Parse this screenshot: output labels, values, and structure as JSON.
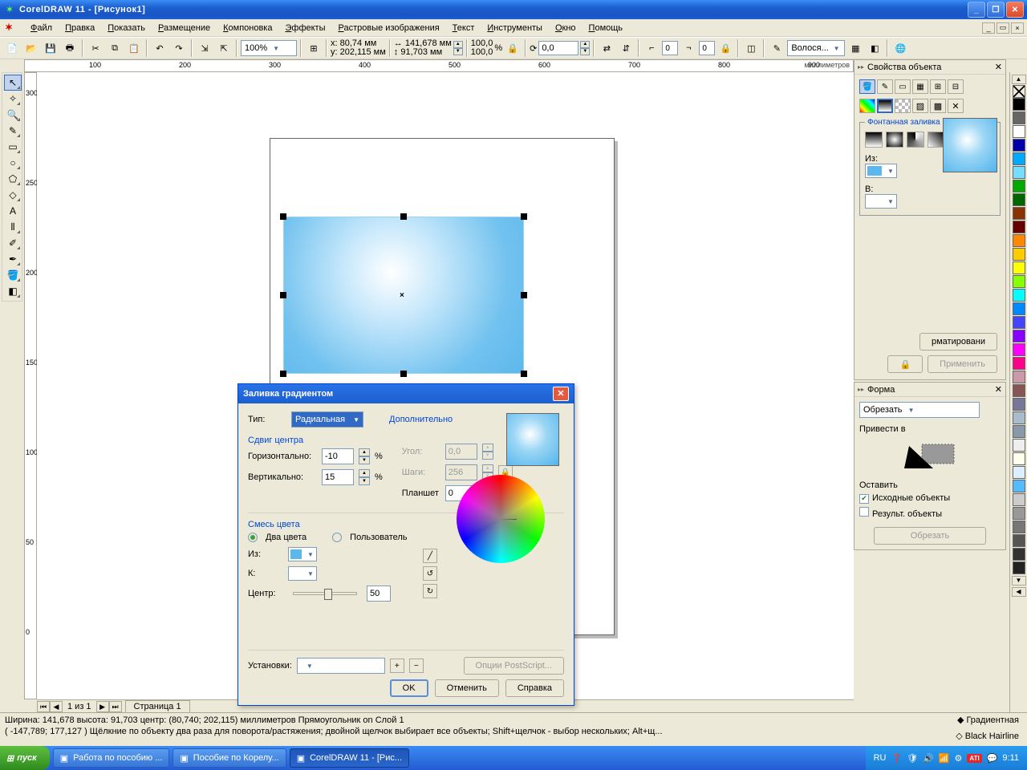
{
  "title": "CorelDRAW 11 - [Рисунок1]",
  "menu": [
    "Файл",
    "Правка",
    "Показать",
    "Размещение",
    "Компоновка",
    "Эффекты",
    "Растровые изображения",
    "Текст",
    "Инструменты",
    "Окно",
    "Помощь"
  ],
  "toolbar": {
    "zoom": "100%",
    "x_label": "x:",
    "x": "80,74 мм",
    "y_label": "y:",
    "y": "202,115 мм",
    "w": "141,678 мм",
    "h": "91,703 мм",
    "sx": "100,0",
    "sy": "100,0",
    "pct": "%",
    "rot": "0,0",
    "outline": "Волося..."
  },
  "ruler_unit": "миллиметров",
  "ruler_h": [
    "100",
    "200",
    "300",
    "400",
    "500",
    "600",
    "700",
    "800",
    "900"
  ],
  "ruler_v": [
    "300",
    "250",
    "200",
    "150",
    "100",
    "50",
    "0"
  ],
  "page_tab": {
    "nav": "1 из 1",
    "tab": "Страница 1"
  },
  "status": {
    "line1": "Ширина: 141,678  высота: 91,703  центр: (80,740; 202,115)  миллиметров              Прямоугольник on Слой 1",
    "line2": "( -147,789; 177,127 )     Щёлкние по объекту два раза для поворота/растяжения; двойной щелчок выбирает все объекты; Shift+щелчок - выбор нескольких; Alt+щ...",
    "r1": "Градиентная",
    "r2": "Black  Hairline"
  },
  "docker1": {
    "title": "Свойства объекта",
    "section": "Фонтанная заливка",
    "from": "Из:",
    "to": "В:",
    "fmt_btn": "рматировани",
    "lock": "🔒",
    "apply": "Применить"
  },
  "docker2": {
    "title": "Форма",
    "combo": "Обрезать",
    "label": "Привести в",
    "keep": "Оставить",
    "opt1": "Исходные объекты",
    "opt2": "Результ. объекты",
    "btn": "Обрезать"
  },
  "dialog": {
    "title": "Заливка градиентом",
    "type_lbl": "Тип:",
    "type_val": "Радиальная",
    "offset": "Сдвиг центра",
    "horiz_lbl": "Горизонтально:",
    "horiz": "-10",
    "vert_lbl": "Вертикально:",
    "vert": "15",
    "pct": "%",
    "extra": "Дополнительно",
    "angle_lbl": "Угол:",
    "angle": "0,0",
    "steps_lbl": "Шаги:",
    "steps": "256",
    "pad_lbl": "Планшет",
    "pad": "0",
    "mix": "Смесь цвета",
    "two": "Два цвета",
    "custom": "Пользователь",
    "from": "Из:",
    "to": "К:",
    "center": "Центр:",
    "center_v": "50",
    "presets": "Установки:",
    "ps": "Опции PostScript...",
    "ok": "OK",
    "cancel": "Отменить",
    "help": "Справка"
  },
  "colors": [
    "#000",
    "#666",
    "#fff",
    "#00a",
    "#0af",
    "#7df",
    "#0a0",
    "#060",
    "#830",
    "#600",
    "#f80",
    "#fc0",
    "#ff0",
    "#8f0",
    "#0ff",
    "#08f",
    "#44f",
    "#80f",
    "#f0f",
    "#f08",
    "#c9a",
    "#855",
    "#779",
    "#abc",
    "#89a",
    "#eee",
    "#ffe",
    "#def",
    "#5bf",
    "#ccc",
    "#999",
    "#777",
    "#555",
    "#333",
    "#222"
  ],
  "taskbar": {
    "start": "пуск",
    "tasks": [
      "Работа по пособию ...",
      "Пособие по Корелу...",
      "CorelDRAW 11 - [Рис..."
    ],
    "lang": "RU",
    "time": "9:11"
  }
}
